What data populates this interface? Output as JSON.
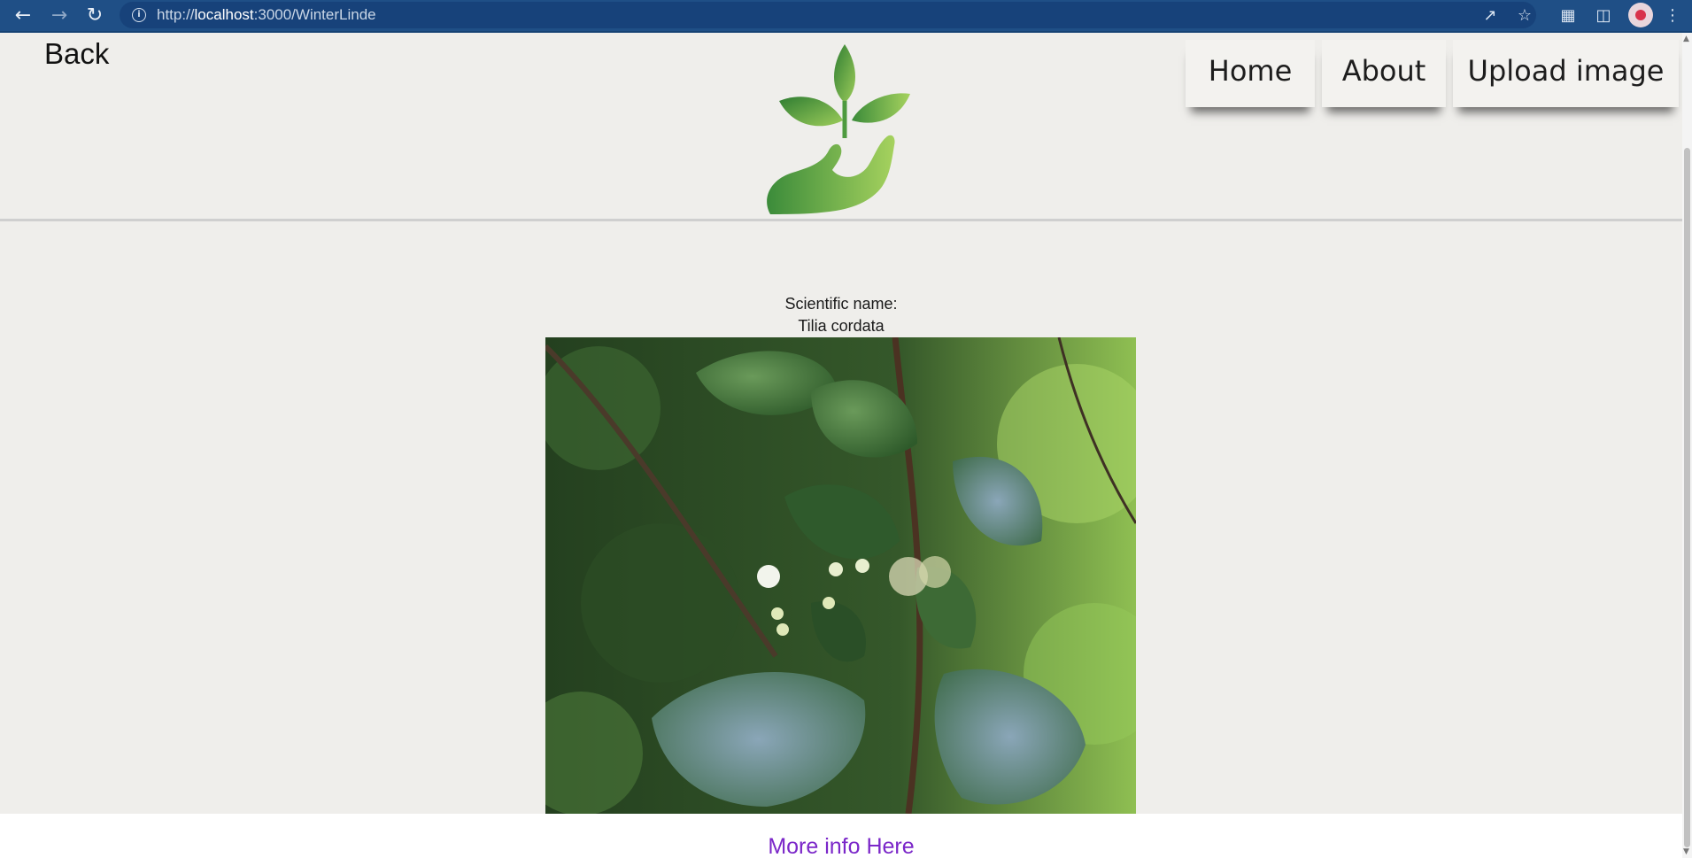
{
  "browser": {
    "url_scheme": "http://",
    "url_host": "localhost",
    "url_path": ":3000/WinterLinde"
  },
  "page": {
    "back_label": "Back",
    "nav": [
      {
        "label": "Home"
      },
      {
        "label": "About"
      },
      {
        "label": "Upload image"
      }
    ],
    "scientific_name_heading": "Scientific name:",
    "scientific_name": "Tilia cordata",
    "more_info_link": "More info Here"
  },
  "colors": {
    "chrome": "#1f4f86",
    "page_background": "#efeeeb",
    "link": "#7b27c9",
    "logo_green": "#4a9a3d"
  },
  "icons": [
    "back-arrow-icon",
    "forward-arrow-icon",
    "reload-icon",
    "site-info-icon",
    "share-icon",
    "bookmark-star-icon",
    "extensions-puzzle-icon",
    "side-panel-icon",
    "profile-avatar-icon",
    "menu-dots-icon"
  ]
}
